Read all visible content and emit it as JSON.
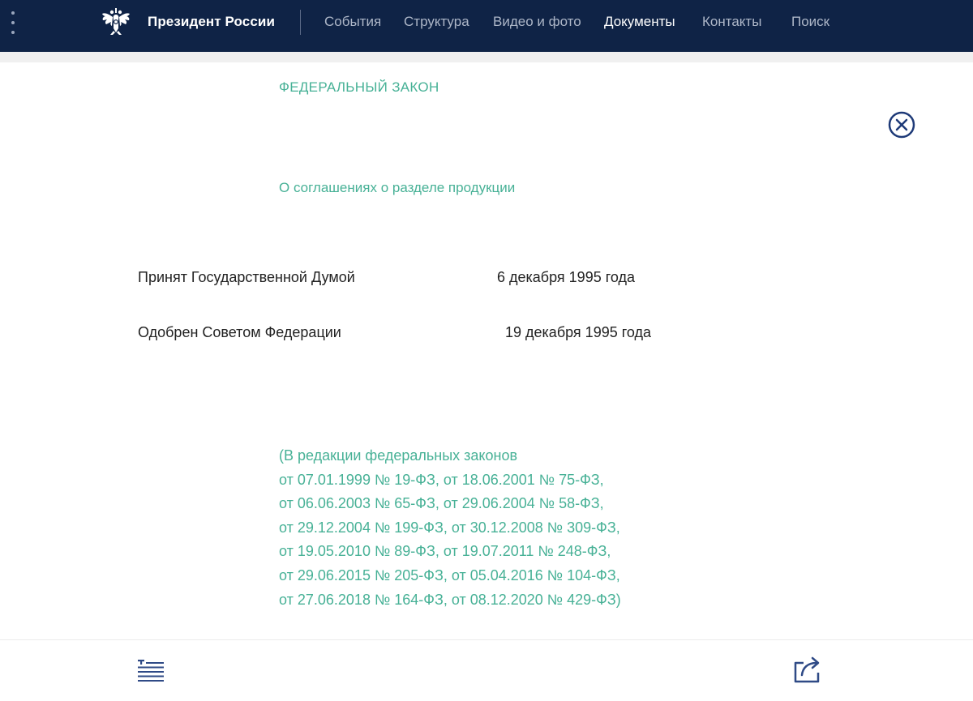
{
  "header": {
    "brand": "Президент России",
    "nav": [
      "События",
      "Структура",
      "Видео и фото",
      "Документы",
      "Контакты",
      "Поиск"
    ],
    "active_nav": "Документы",
    "background_color": "#0f2346"
  },
  "document": {
    "label": "ФЕДЕРАЛЬНЫЙ ЗАКОН",
    "title": "О соглашениях о разделе продукции",
    "adoption": [
      {
        "label": "Принят Государственной Думой",
        "date": "6 декабря 1995 года"
      },
      {
        "label": "Одобрен Советом Федерации",
        "date": "19 декабря 1995 года"
      }
    ],
    "amendments": [
      "(В редакции федеральных законов",
      "от 07.01.1999 № 19-ФЗ, от 18.06.2001 № 75-ФЗ,",
      "от 06.06.2003 № 65-ФЗ, от 29.06.2004 № 58-ФЗ,",
      "от 29.12.2004 № 199-ФЗ, от 30.12.2008 № 309-ФЗ,",
      "от 19.05.2010 № 89-ФЗ, от 19.07.2011 № 248-ФЗ,",
      "от 29.06.2015 № 205-ФЗ, от 05.04.2016 № 104-ФЗ,",
      "от 27.06.2018 № 164-ФЗ, от 08.12.2020 № 429-ФЗ)"
    ],
    "accent_color": "#47b196"
  },
  "icons": {
    "menu": "more-vertical-icon",
    "emblem": "eagle-emblem-icon",
    "close": "close-circle-icon",
    "toc": "table-of-contents-icon",
    "share": "share-icon"
  }
}
